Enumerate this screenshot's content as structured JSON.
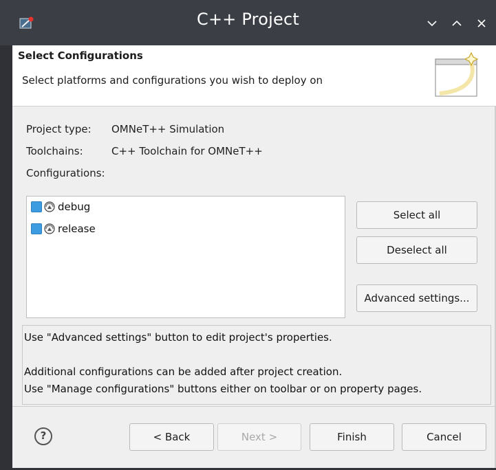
{
  "window": {
    "title": "C++ Project"
  },
  "header": {
    "title": "Select Configurations",
    "description": "Select platforms and configurations you wish to deploy on"
  },
  "info": {
    "project_type_label": "Project type:",
    "project_type_value": "OMNeT++ Simulation",
    "toolchains_label": "Toolchains:",
    "toolchains_value": "C++ Toolchain for OMNeT++",
    "configurations_label": "Configurations:"
  },
  "configurations": [
    {
      "label": "debug",
      "checked": true
    },
    {
      "label": "release",
      "checked": true
    }
  ],
  "side_buttons": {
    "select_all": "Select all",
    "deselect_all": "Deselect all",
    "advanced": "Advanced settings..."
  },
  "messages": {
    "line1": "Use \"Advanced settings\" button to edit project's properties.",
    "line2": "Additional configurations can be added after project creation.",
    "line3": "Use \"Manage configurations\" buttons either on toolbar or on property pages."
  },
  "footer": {
    "help": "?",
    "back": "< Back",
    "next": "Next >",
    "finish": "Finish",
    "cancel": "Cancel"
  },
  "colors": {
    "titlebar": "#3b3f45",
    "checkbox": "#3d9be0",
    "dialog_bg": "#efefef"
  }
}
